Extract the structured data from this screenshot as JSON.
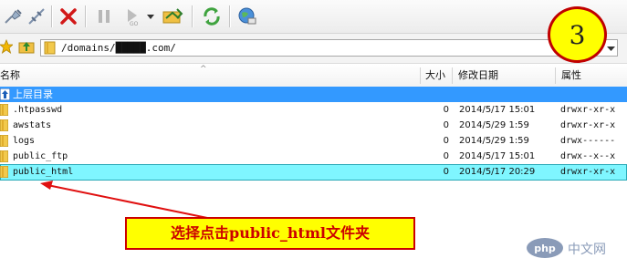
{
  "toolbar": {
    "buttons": [
      {
        "name": "connect-icon"
      },
      {
        "name": "disconnect-icon"
      },
      {
        "name": "abort-icon"
      },
      {
        "name": "pause-icon"
      },
      {
        "name": "execute-icon"
      },
      {
        "name": "dropdown-icon"
      },
      {
        "name": "transfer-icon"
      },
      {
        "name": "refresh-icon"
      },
      {
        "name": "globe-icon"
      }
    ],
    "accent_colors": {
      "abort": "#d21818",
      "refresh": "#3fa33f",
      "badge_border": "#c00000"
    }
  },
  "address": {
    "path": "/domains/█████.com/"
  },
  "step_badge": "3",
  "columns": {
    "name": "名称",
    "size": "大小",
    "date": "修改日期",
    "attr": "属性"
  },
  "rows": [
    {
      "name": "上层目录",
      "size": "",
      "date": "",
      "attr": "",
      "icon": "up-folder-icon"
    },
    {
      "name": ".htpasswd",
      "size": "0",
      "date": "2014/5/17 15:01",
      "attr": "drwxr-xr-x",
      "icon": "folder-icon"
    },
    {
      "name": "awstats",
      "size": "0",
      "date": "2014/5/29 1:59",
      "attr": "drwxr-xr-x",
      "icon": "folder-icon"
    },
    {
      "name": "logs",
      "size": "0",
      "date": "2014/5/29 1:59",
      "attr": "drwx------",
      "icon": "folder-icon"
    },
    {
      "name": "public_ftp",
      "size": "0",
      "date": "2014/5/17 15:01",
      "attr": "drwx--x--x",
      "icon": "folder-icon"
    },
    {
      "name": "public_html",
      "size": "0",
      "date": "2014/5/17 20:29",
      "attr": "drwxr-xr-x",
      "icon": "folder-icon"
    }
  ],
  "annotation": {
    "text": "选择点击public_html文件夹",
    "color": "#cc0000",
    "bg": "#ffff00"
  },
  "watermark": {
    "logo": "php",
    "text": "中文网"
  }
}
